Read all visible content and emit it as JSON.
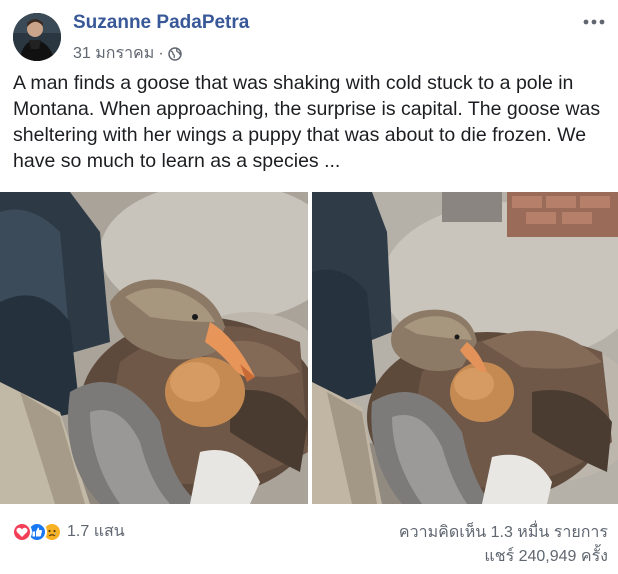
{
  "post": {
    "author": "Suzanne PadaPetra",
    "date": "31 มกราคม",
    "separator": "·",
    "audience_icon": "globe-icon",
    "menu_icon": "more-dots-icon",
    "message": "A man finds a goose that was shaking with cold stuck to a pole in Montana. When approaching, the surprise is capital. The goose was sheltering with her wings a puppy that was about to die frozen. We have so much to learn as a species ..."
  },
  "photos": [
    {
      "subject": "goose-with-puppy-photo"
    },
    {
      "subject": "goose-with-puppy-photo"
    }
  ],
  "footer": {
    "reaction_icons": [
      "love-icon",
      "like-icon",
      "sad-icon"
    ],
    "reaction_count": "1.7 แสน",
    "comment_count": "ความคิดเห็น 1.3 หมื่น รายการ",
    "share_count": "แชร์ 240,949 ครั้ง"
  },
  "colors": {
    "author_link": "#385898",
    "secondary_text": "#606770",
    "love": "#f33e58",
    "like": "#1877f2",
    "sad": "#f7b125"
  }
}
